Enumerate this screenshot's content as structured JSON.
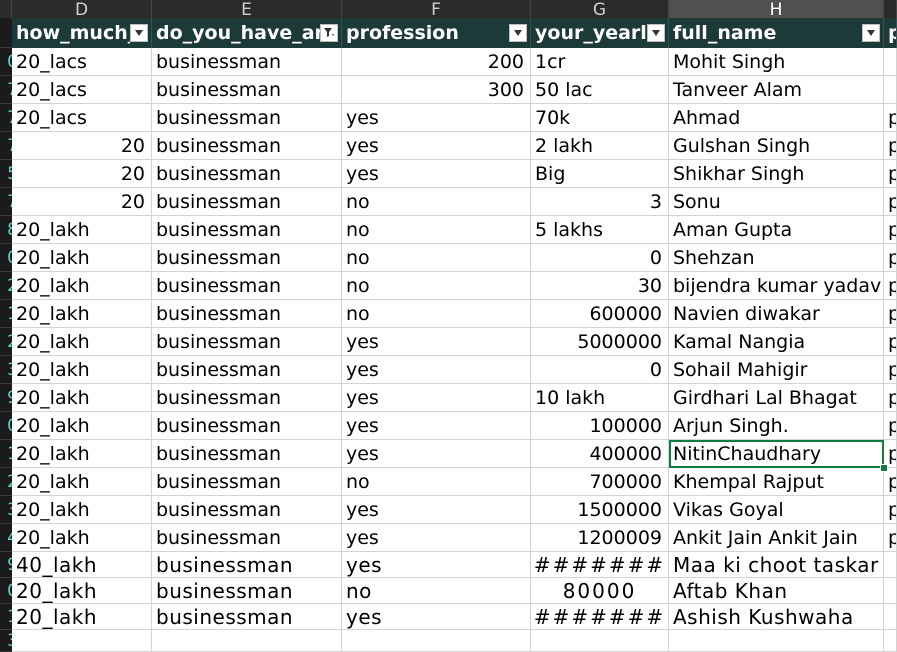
{
  "column_letters": [
    {
      "id": "c",
      "label": ""
    },
    {
      "id": "d",
      "label": "D"
    },
    {
      "id": "e",
      "label": "E"
    },
    {
      "id": "f",
      "label": "F"
    },
    {
      "id": "g",
      "label": "G"
    },
    {
      "id": "h",
      "label": "H",
      "active": true
    },
    {
      "id": "i",
      "label": ""
    }
  ],
  "headers": [
    {
      "id": "how_much",
      "label": "how_much_",
      "filter": "dropdown"
    },
    {
      "id": "do_you_have",
      "label": "do_you_have_any",
      "filter": "funnel"
    },
    {
      "id": "profession",
      "label": "profession",
      "filter": "dropdown"
    },
    {
      "id": "yearly",
      "label": "your_yearly_",
      "filter": "dropdown"
    },
    {
      "id": "full_name",
      "label": "full_name",
      "filter": "dropdown"
    },
    {
      "id": "next",
      "label": "p",
      "filter": "none"
    }
  ],
  "rows": [
    {
      "rn": "0",
      "cells": [
        "20_lacs",
        "businessman",
        "200",
        "1cr",
        "Mohit Singh",
        ""
      ],
      "num": [
        false,
        false,
        true,
        false,
        false,
        false
      ]
    },
    {
      "rn": "7",
      "cells": [
        "20_lacs",
        "businessman",
        "300",
        "50 lac",
        "Tanveer Alam",
        ""
      ],
      "num": [
        false,
        false,
        true,
        false,
        false,
        false
      ]
    },
    {
      "rn": "7",
      "cells": [
        "20_lacs",
        "businessman",
        "yes",
        "70k",
        "Ahmad",
        "p"
      ],
      "num": [
        false,
        false,
        false,
        false,
        false,
        false
      ]
    },
    {
      "rn": "7",
      "cells": [
        "20",
        "businessman",
        "yes",
        "2 lakh",
        "Gulshan Singh",
        "p"
      ],
      "num": [
        true,
        false,
        false,
        false,
        false,
        false
      ]
    },
    {
      "rn": "5",
      "cells": [
        "20",
        "businessman",
        "yes",
        "Big",
        "Shikhar Singh",
        "p"
      ],
      "num": [
        true,
        false,
        false,
        false,
        false,
        false
      ]
    },
    {
      "rn": "7",
      "cells": [
        "20",
        "businessman",
        "no",
        "3",
        "Sonu",
        "p"
      ],
      "num": [
        true,
        false,
        false,
        true,
        false,
        false
      ]
    },
    {
      "rn": "8",
      "cells": [
        "20_lakh",
        "businessman",
        "no",
        "5 lakhs",
        "Aman Gupta",
        "p"
      ],
      "num": [
        false,
        false,
        false,
        false,
        false,
        false
      ]
    },
    {
      "rn": "0",
      "cells": [
        "20_lakh",
        "businessman",
        "no",
        "0",
        "Shehzan",
        "p"
      ],
      "num": [
        false,
        false,
        false,
        true,
        false,
        false
      ]
    },
    {
      "rn": "2",
      "cells": [
        "20_lakh",
        "businessman",
        "no",
        "30",
        "bijendra kumar yadav",
        "p"
      ],
      "num": [
        false,
        false,
        false,
        true,
        false,
        false
      ]
    },
    {
      "rn": "1",
      "cells": [
        "20_lakh",
        "businessman",
        "no",
        "600000",
        "Navien diwakar",
        "p"
      ],
      "num": [
        false,
        false,
        false,
        true,
        false,
        false
      ]
    },
    {
      "rn": "2",
      "cells": [
        "20_lakh",
        "businessman",
        "yes",
        "5000000",
        "Kamal Nangia",
        "p"
      ],
      "num": [
        false,
        false,
        false,
        true,
        false,
        false
      ]
    },
    {
      "rn": "3",
      "cells": [
        "20_lakh",
        "businessman",
        "yes",
        "0",
        "Sohail Mahigir",
        "p"
      ],
      "num": [
        false,
        false,
        false,
        true,
        false,
        false
      ]
    },
    {
      "rn": "9",
      "cells": [
        "20_lakh",
        "businessman",
        "yes",
        "10 lakh",
        "Girdhari Lal Bhagat",
        "p"
      ],
      "num": [
        false,
        false,
        false,
        false,
        false,
        false
      ]
    },
    {
      "rn": "0",
      "cells": [
        "20_lakh",
        "businessman",
        "yes",
        "100000",
        "Arjun Singh.",
        "p"
      ],
      "num": [
        false,
        false,
        false,
        true,
        false,
        false
      ]
    },
    {
      "rn": "1",
      "cells": [
        "20_lakh",
        "businessman",
        "yes",
        "400000",
        "NitinChaudhary",
        "p"
      ],
      "num": [
        false,
        false,
        false,
        true,
        false,
        false
      ],
      "selected": 4
    },
    {
      "rn": "2",
      "cells": [
        "20_lakh",
        "businessman",
        "no",
        "700000",
        "Khempal Rajput",
        "p"
      ],
      "num": [
        false,
        false,
        false,
        true,
        false,
        false
      ]
    },
    {
      "rn": "3",
      "cells": [
        "20_lakh",
        "businessman",
        "yes",
        "1500000",
        "Vikas Goyal",
        "p"
      ],
      "num": [
        false,
        false,
        false,
        true,
        false,
        false
      ]
    },
    {
      "rn": "4",
      "cells": [
        "20_lakh",
        "businessman",
        "yes",
        "1200009",
        "Ankit Jain Ankit Jain",
        "p"
      ],
      "num": [
        false,
        false,
        false,
        true,
        false,
        false
      ]
    },
    {
      "rn": "9",
      "cells": [
        "40_lakh",
        "businessman",
        "yes",
        "#######",
        "Maa ki choot taskar k",
        ""
      ],
      "num": [
        false,
        false,
        false,
        false,
        false,
        false
      ],
      "big": true,
      "hash": 3
    },
    {
      "rn": "0",
      "cells": [
        "20_lakh",
        "businessman",
        "no",
        "80000",
        "Aftab Khan",
        ""
      ],
      "num": [
        false,
        false,
        false,
        false,
        false,
        false
      ],
      "big": true,
      "center": 3
    },
    {
      "rn": "1",
      "cells": [
        "20_lakh",
        "businessman",
        "yes",
        "#######",
        "Ashish Kushwaha",
        ""
      ],
      "num": [
        false,
        false,
        false,
        false,
        false,
        false
      ],
      "big": true,
      "hash": 3
    },
    {
      "rn": "3",
      "cells": [
        "",
        "",
        "",
        "",
        "",
        ""
      ],
      "num": [
        false,
        false,
        false,
        false,
        false,
        false
      ]
    }
  ]
}
